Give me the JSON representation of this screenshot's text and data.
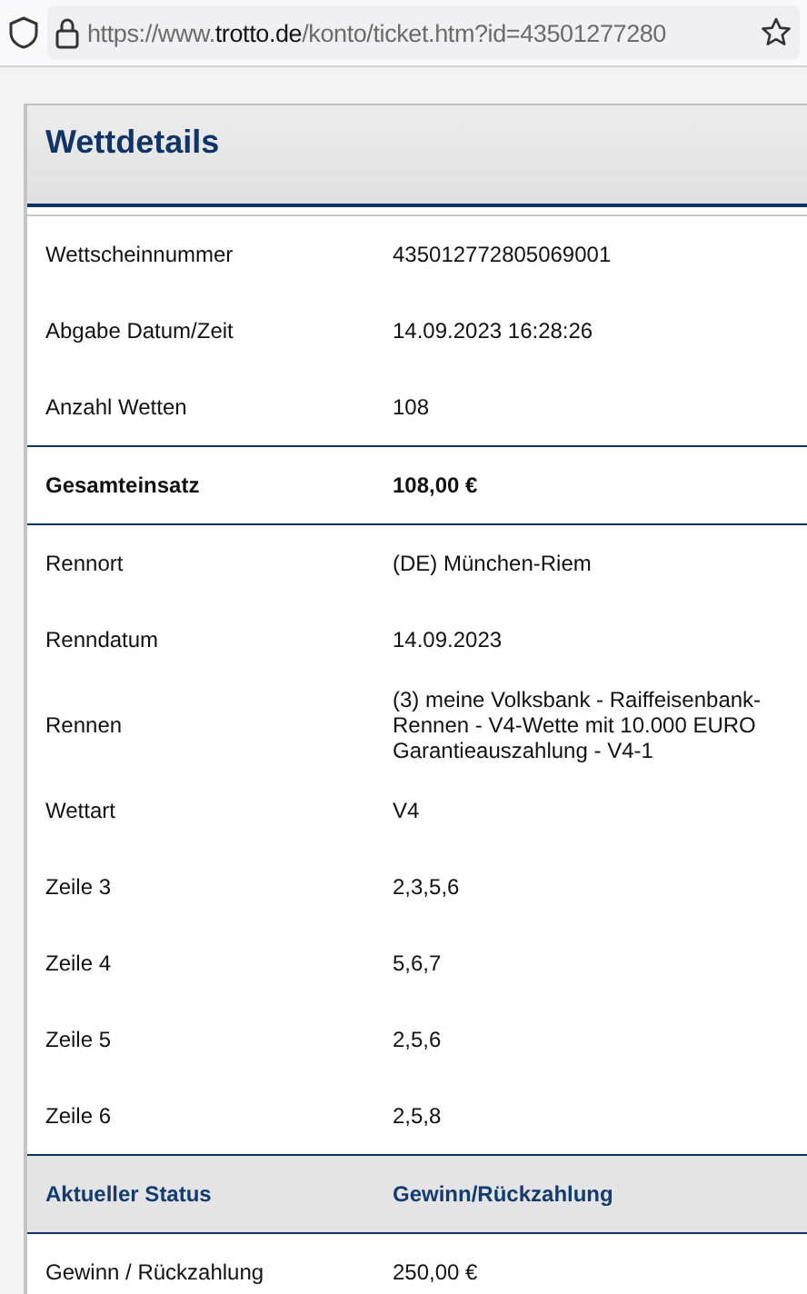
{
  "browser": {
    "url_scheme": "https://www.",
    "url_domain": "trotto.de",
    "url_path": "/konto/ticket.htm?id=43501277280"
  },
  "panel": {
    "title": "Wettdetails"
  },
  "rows": [
    {
      "kind": "normal",
      "label": "Wettscheinnummer",
      "value": "435012772805069001"
    },
    {
      "kind": "normal",
      "label": "Abgabe Datum/Zeit",
      "value": "14.09.2023 16:28:26"
    },
    {
      "kind": "normal",
      "label": "Anzahl Wetten",
      "value": "108"
    },
    {
      "kind": "total",
      "label": "Gesamteinsatz",
      "value": "108,00 €"
    },
    {
      "kind": "normal",
      "label": "Rennort",
      "value": "(DE) München-Riem"
    },
    {
      "kind": "normal",
      "label": "Renndatum",
      "value": "14.09.2023"
    },
    {
      "kind": "normal",
      "label": "Rennen",
      "value": "(3) meine Volksbank - Raiffeisenbank-Rennen - V4-Wette mit 10.000 EURO Garantieauszahlung - V4-1"
    },
    {
      "kind": "normal",
      "label": "Wettart",
      "value": "V4"
    },
    {
      "kind": "normal",
      "label": "Zeile 3",
      "value": "2,3,5,6"
    },
    {
      "kind": "normal",
      "label": "Zeile 4",
      "value": "5,6,7"
    },
    {
      "kind": "normal",
      "label": "Zeile 5",
      "value": "2,5,6"
    },
    {
      "kind": "normal",
      "label": "Zeile 6",
      "value": "2,5,8"
    },
    {
      "kind": "header",
      "label": "Aktueller Status",
      "value": "Gewinn/Rückzahlung"
    },
    {
      "kind": "normal",
      "label": "Gewinn / Rückzahlung",
      "value": "250,00 €"
    }
  ]
}
